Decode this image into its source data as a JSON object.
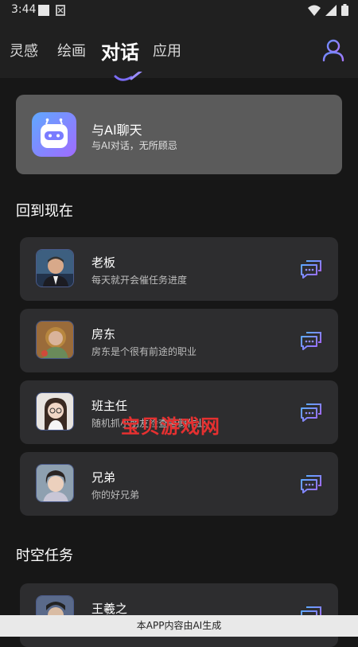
{
  "status_bar": {
    "time": "3:44"
  },
  "nav": {
    "tabs": [
      {
        "label": "灵感"
      },
      {
        "label": "绘画"
      },
      {
        "label": "对话"
      },
      {
        "label": "应用"
      }
    ],
    "active_tab": "对话",
    "accent_color": "#7b6cf6"
  },
  "ai_chat": {
    "title": "与AI聊天",
    "subtitle": "与AI对话，无所顾忌"
  },
  "sections": {
    "back_to_now": "回到现在",
    "time_space_tasks": "时空任务"
  },
  "characters": [
    {
      "name": "老板",
      "desc": "每天就开会催任务进度"
    },
    {
      "name": "房东",
      "desc": "房东是个很有前途的职业"
    },
    {
      "name": "班主任",
      "desc": "随机抓小朋友检查暑假作业"
    },
    {
      "name": "兄弟",
      "desc": "你的好兄弟"
    }
  ],
  "tasks": [
    {
      "name": "王羲之"
    }
  ],
  "watermark": "宝贝游戏网",
  "footer": {
    "text": "本APP内容由AI生成"
  }
}
